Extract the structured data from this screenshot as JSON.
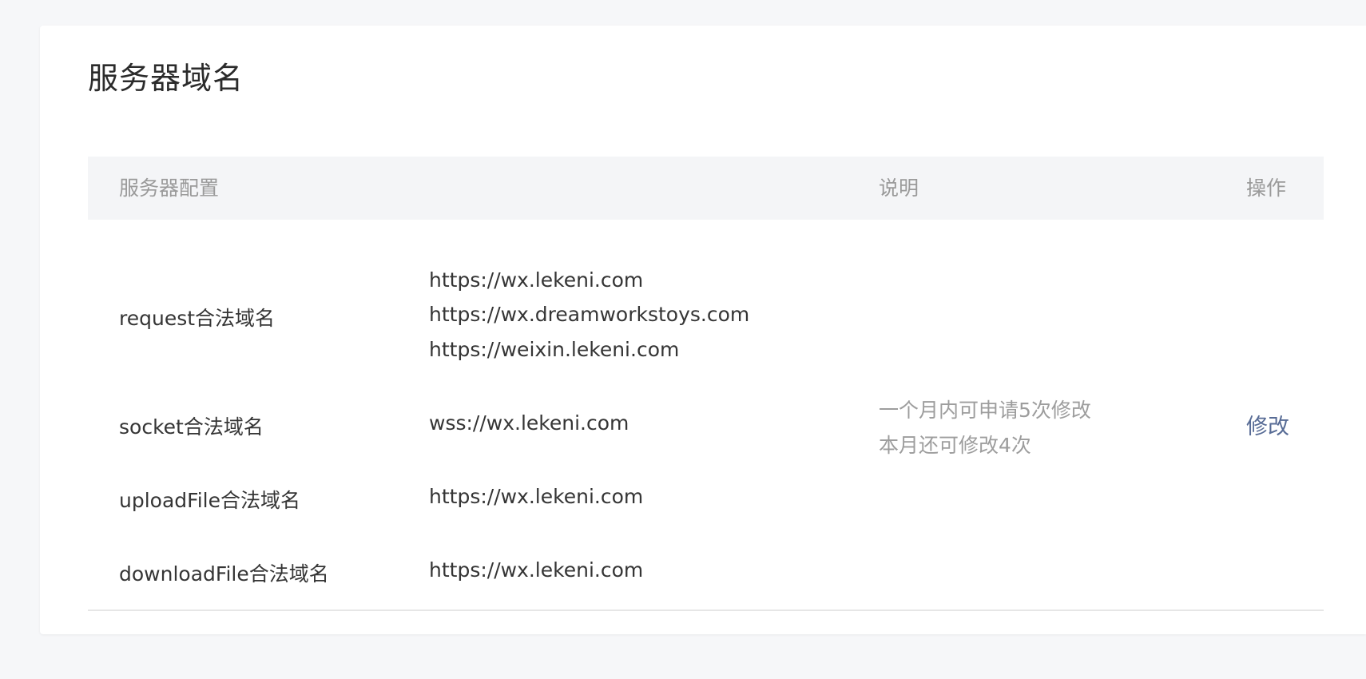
{
  "page": {
    "title": "服务器域名"
  },
  "table": {
    "headers": {
      "config": "服务器配置",
      "description": "说明",
      "operation": "操作"
    },
    "rows": [
      {
        "label": "request合法域名",
        "domains": [
          "https://wx.lekeni.com",
          "https://wx.dreamworkstoys.com",
          "https://weixin.lekeni.com"
        ]
      },
      {
        "label": "socket合法域名",
        "domains": [
          "wss://wx.lekeni.com"
        ]
      },
      {
        "label": "uploadFile合法域名",
        "domains": [
          "https://wx.lekeni.com"
        ]
      },
      {
        "label": "downloadFile合法域名",
        "domains": [
          "https://wx.lekeni.com"
        ]
      }
    ],
    "description_lines": [
      "一个月内可申请5次修改",
      "本月还可修改4次"
    ],
    "modify_label": "修改"
  },
  "colors": {
    "background": "#f6f7f9",
    "card": "#ffffff",
    "header_bg": "#f4f5f7",
    "link": "#576b95",
    "muted_text": "#9a9a9a",
    "primary_text": "#353535"
  }
}
